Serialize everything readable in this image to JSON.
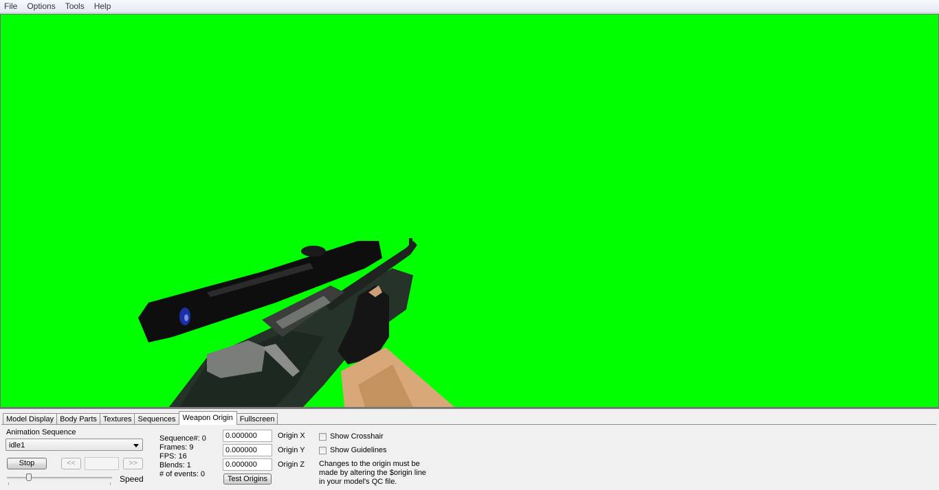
{
  "menubar": {
    "items": [
      "File",
      "Options",
      "Tools",
      "Help"
    ]
  },
  "viewport": {
    "background_color": "#00ff00",
    "content": "weapon-model-sniper-rifle"
  },
  "tabs": [
    {
      "label": "Model Display",
      "active": false
    },
    {
      "label": "Body Parts",
      "active": false
    },
    {
      "label": "Textures",
      "active": false
    },
    {
      "label": "Sequences",
      "active": false
    },
    {
      "label": "Weapon Origin",
      "active": true
    },
    {
      "label": "Fullscreen",
      "active": false
    }
  ],
  "animation": {
    "label": "Animation Sequence",
    "selected": "idle1",
    "stop_label": "Stop",
    "prev_label": "<<",
    "next_label": ">>",
    "frame_value": "",
    "speed_label": "Speed",
    "speed_fraction": 0.2
  },
  "sequence_info": {
    "sequence": "Sequence#: 0",
    "frames": "Frames: 9",
    "fps": "FPS: 16",
    "blends": "Blends: 1",
    "events": "# of events: 0"
  },
  "origin": {
    "x": {
      "value": "0.000000",
      "label": "Origin X"
    },
    "y": {
      "value": "0.000000",
      "label": "Origin Y"
    },
    "z": {
      "value": "0.000000",
      "label": "Origin Z"
    },
    "test_label": "Test Origins"
  },
  "options": {
    "show_crosshair": {
      "label": "Show Crosshair",
      "checked": false
    },
    "show_guidelines": {
      "label": "Show Guidelines",
      "checked": false
    }
  },
  "note": {
    "line1": "Changes to the origin must be",
    "line2": "made by altering the $origin line",
    "line3": "in your model's QC file."
  }
}
